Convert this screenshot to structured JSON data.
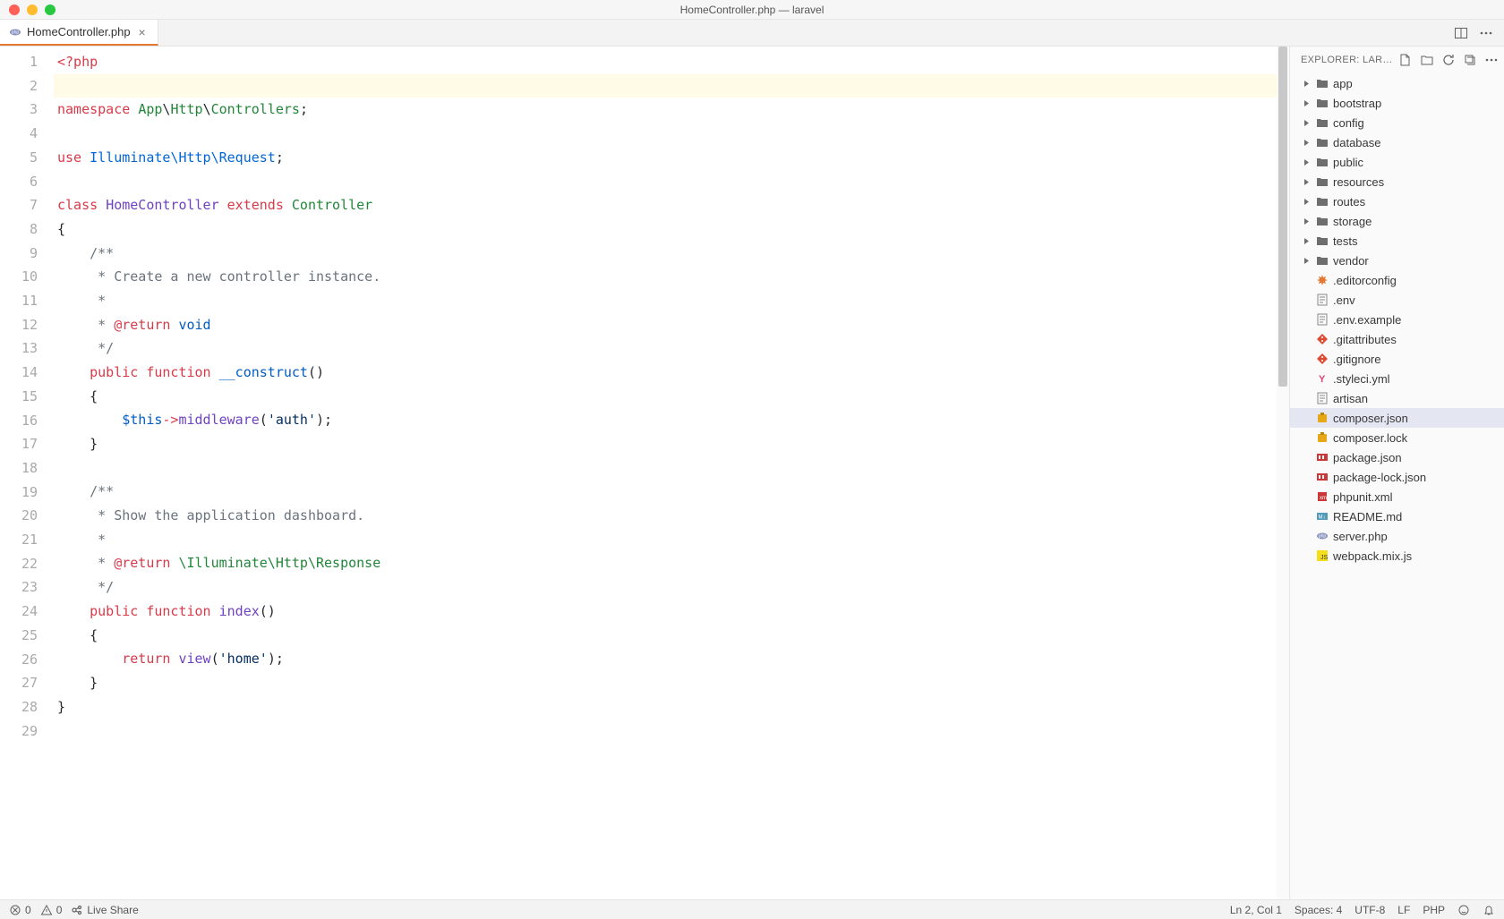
{
  "window": {
    "title": "HomeController.php — laravel"
  },
  "tab": {
    "filename": "HomeController.php"
  },
  "code": {
    "lines": [
      {
        "n": 1,
        "segs": [
          {
            "t": "<?php",
            "c": "k-red"
          }
        ]
      },
      {
        "n": 2,
        "hl": true,
        "segs": []
      },
      {
        "n": 3,
        "segs": [
          {
            "t": "namespace ",
            "c": "k-red"
          },
          {
            "t": "App",
            "c": "k-green"
          },
          {
            "t": "\\",
            "c": "k-text"
          },
          {
            "t": "Http",
            "c": "k-green"
          },
          {
            "t": "\\",
            "c": "k-text"
          },
          {
            "t": "Controllers",
            "c": "k-green"
          },
          {
            "t": ";",
            "c": "k-text"
          }
        ]
      },
      {
        "n": 4,
        "segs": []
      },
      {
        "n": 5,
        "segs": [
          {
            "t": "use ",
            "c": "k-red"
          },
          {
            "t": "Illuminate",
            "c": "k-lightblue"
          },
          {
            "t": "\\",
            "c": "k-lightblue"
          },
          {
            "t": "Http",
            "c": "k-lightblue"
          },
          {
            "t": "\\",
            "c": "k-lightblue"
          },
          {
            "t": "Request",
            "c": "k-lightblue"
          },
          {
            "t": ";",
            "c": "k-text"
          }
        ]
      },
      {
        "n": 6,
        "segs": []
      },
      {
        "n": 7,
        "segs": [
          {
            "t": "class ",
            "c": "k-red"
          },
          {
            "t": "HomeController",
            "c": "k-purple"
          },
          {
            "t": " extends ",
            "c": "k-red"
          },
          {
            "t": "Controller",
            "c": "k-green"
          }
        ]
      },
      {
        "n": 8,
        "segs": [
          {
            "t": "{",
            "c": "k-text"
          }
        ]
      },
      {
        "n": 9,
        "segs": [
          {
            "t": "    /**",
            "c": "k-gray"
          }
        ]
      },
      {
        "n": 10,
        "segs": [
          {
            "t": "     * Create a new controller instance.",
            "c": "k-gray"
          }
        ]
      },
      {
        "n": 11,
        "segs": [
          {
            "t": "     *",
            "c": "k-gray"
          }
        ]
      },
      {
        "n": 12,
        "segs": [
          {
            "t": "     * ",
            "c": "k-gray"
          },
          {
            "t": "@return",
            "c": "k-red"
          },
          {
            "t": " void",
            "c": "k-blue"
          }
        ]
      },
      {
        "n": 13,
        "segs": [
          {
            "t": "     */",
            "c": "k-gray"
          }
        ]
      },
      {
        "n": 14,
        "segs": [
          {
            "t": "    ",
            "c": ""
          },
          {
            "t": "public ",
            "c": "k-red"
          },
          {
            "t": "function ",
            "c": "k-red"
          },
          {
            "t": "__construct",
            "c": "k-blue"
          },
          {
            "t": "()",
            "c": "k-text"
          }
        ]
      },
      {
        "n": 15,
        "segs": [
          {
            "t": "    {",
            "c": "k-text"
          }
        ]
      },
      {
        "n": 16,
        "segs": [
          {
            "t": "        ",
            "c": ""
          },
          {
            "t": "$this",
            "c": "k-blue"
          },
          {
            "t": "->",
            "c": "k-red"
          },
          {
            "t": "middleware",
            "c": "k-purple"
          },
          {
            "t": "(",
            "c": "k-text"
          },
          {
            "t": "'auth'",
            "c": "k-dblue"
          },
          {
            "t": ");",
            "c": "k-text"
          }
        ]
      },
      {
        "n": 17,
        "segs": [
          {
            "t": "    }",
            "c": "k-text"
          }
        ]
      },
      {
        "n": 18,
        "segs": []
      },
      {
        "n": 19,
        "segs": [
          {
            "t": "    /**",
            "c": "k-gray"
          }
        ]
      },
      {
        "n": 20,
        "segs": [
          {
            "t": "     * Show the application dashboard.",
            "c": "k-gray"
          }
        ]
      },
      {
        "n": 21,
        "segs": [
          {
            "t": "     *",
            "c": "k-gray"
          }
        ]
      },
      {
        "n": 22,
        "segs": [
          {
            "t": "     * ",
            "c": "k-gray"
          },
          {
            "t": "@return",
            "c": "k-red"
          },
          {
            "t": " \\Illuminate\\Http\\Response",
            "c": "k-green"
          }
        ]
      },
      {
        "n": 23,
        "segs": [
          {
            "t": "     */",
            "c": "k-gray"
          }
        ]
      },
      {
        "n": 24,
        "segs": [
          {
            "t": "    ",
            "c": ""
          },
          {
            "t": "public ",
            "c": "k-red"
          },
          {
            "t": "function ",
            "c": "k-red"
          },
          {
            "t": "index",
            "c": "k-purple"
          },
          {
            "t": "()",
            "c": "k-text"
          }
        ]
      },
      {
        "n": 25,
        "segs": [
          {
            "t": "    {",
            "c": "k-text"
          }
        ]
      },
      {
        "n": 26,
        "segs": [
          {
            "t": "        ",
            "c": ""
          },
          {
            "t": "return ",
            "c": "k-red"
          },
          {
            "t": "view",
            "c": "k-purple"
          },
          {
            "t": "(",
            "c": "k-text"
          },
          {
            "t": "'home'",
            "c": "k-dblue"
          },
          {
            "t": ");",
            "c": "k-text"
          }
        ]
      },
      {
        "n": 27,
        "segs": [
          {
            "t": "    }",
            "c": "k-text"
          }
        ]
      },
      {
        "n": 28,
        "segs": [
          {
            "t": "}",
            "c": "k-text"
          }
        ]
      },
      {
        "n": 29,
        "segs": []
      }
    ]
  },
  "explorer": {
    "title": "EXPLORER: LARA...",
    "items": [
      {
        "type": "folder",
        "name": "app"
      },
      {
        "type": "folder",
        "name": "bootstrap"
      },
      {
        "type": "folder",
        "name": "config"
      },
      {
        "type": "folder",
        "name": "database"
      },
      {
        "type": "folder",
        "name": "public"
      },
      {
        "type": "folder",
        "name": "resources"
      },
      {
        "type": "folder",
        "name": "routes"
      },
      {
        "type": "folder",
        "name": "storage"
      },
      {
        "type": "folder",
        "name": "tests"
      },
      {
        "type": "folder",
        "name": "vendor"
      },
      {
        "type": "file",
        "name": ".editorconfig",
        "icon": "editorconfig"
      },
      {
        "type": "file",
        "name": ".env",
        "icon": "text"
      },
      {
        "type": "file",
        "name": ".env.example",
        "icon": "text"
      },
      {
        "type": "file",
        "name": ".gitattributes",
        "icon": "git"
      },
      {
        "type": "file",
        "name": ".gitignore",
        "icon": "git"
      },
      {
        "type": "file",
        "name": ".styleci.yml",
        "icon": "styleci"
      },
      {
        "type": "file",
        "name": "artisan",
        "icon": "text"
      },
      {
        "type": "file",
        "name": "composer.json",
        "icon": "composer",
        "selected": true
      },
      {
        "type": "file",
        "name": "composer.lock",
        "icon": "composer"
      },
      {
        "type": "file",
        "name": "package.json",
        "icon": "npm"
      },
      {
        "type": "file",
        "name": "package-lock.json",
        "icon": "npm"
      },
      {
        "type": "file",
        "name": "phpunit.xml",
        "icon": "xml"
      },
      {
        "type": "file",
        "name": "README.md",
        "icon": "md"
      },
      {
        "type": "file",
        "name": "server.php",
        "icon": "php"
      },
      {
        "type": "file",
        "name": "webpack.mix.js",
        "icon": "js"
      }
    ]
  },
  "status": {
    "errors": "0",
    "warnings": "0",
    "liveshare": "Live Share",
    "position": "Ln 2, Col 1",
    "spaces": "Spaces: 4",
    "encoding": "UTF-8",
    "eol": "LF",
    "language": "PHP"
  }
}
